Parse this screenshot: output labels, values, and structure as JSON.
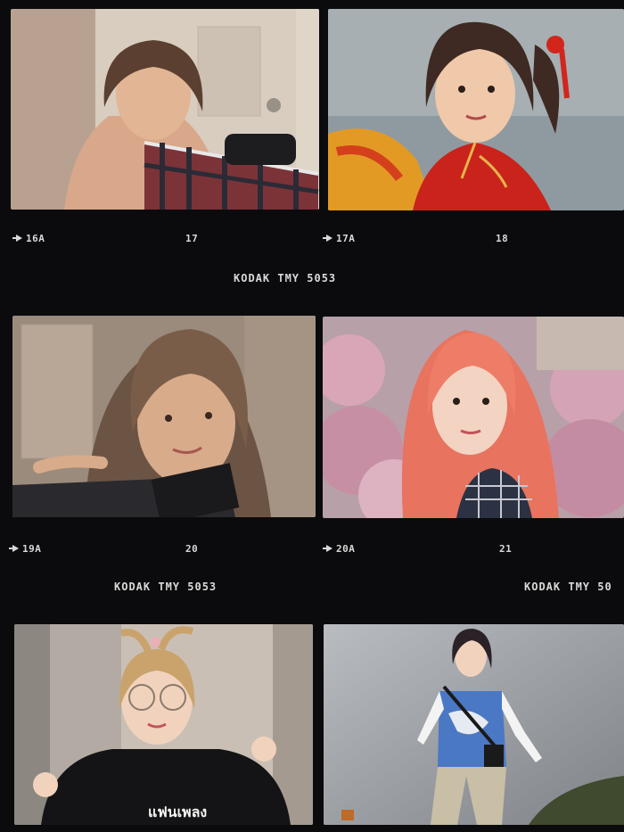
{
  "film": {
    "rows": [
      {
        "left_frame_label": "16A",
        "right_frame_number_left": "17",
        "right_frame_label": "17A",
        "right_frame_number_right": "18",
        "brand": "KODAK TMY 5053"
      },
      {
        "left_frame_label": "19A",
        "right_frame_number_left": "20",
        "right_frame_label": "20A",
        "right_frame_number_right": "21",
        "brand_left": "KODAK TMY 5053",
        "brand_right": "KODAK TMY 50"
      }
    ],
    "shirt_text": "แฟนเพลง",
    "colors": {
      "film_black": "#0b0b0d",
      "label": "#d9d9d9",
      "pink_hair": "#e8735f",
      "red_dress": "#c9231c",
      "blue_vest": "#4a78c4"
    }
  },
  "photos": [
    {
      "id": "photo-1",
      "subject": "girl-plaid-shirt-indoors"
    },
    {
      "id": "photo-2",
      "subject": "girl-red-qipao-pigtails"
    },
    {
      "id": "photo-3",
      "subject": "girl-selfie-holding-phone"
    },
    {
      "id": "photo-4",
      "subject": "girl-pink-hair-flowers"
    },
    {
      "id": "photo-5",
      "subject": "girl-glasses-black-tshirt"
    },
    {
      "id": "photo-6",
      "subject": "girl-blue-vest-full-body"
    }
  ]
}
